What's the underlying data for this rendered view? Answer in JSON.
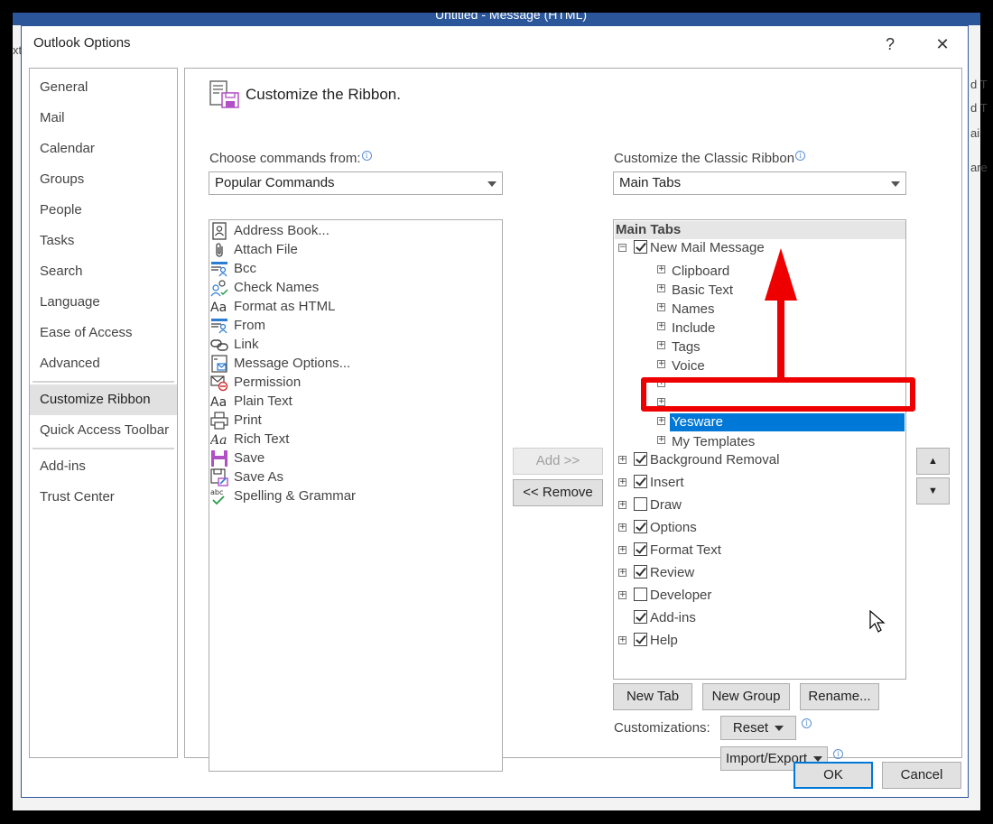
{
  "background": {
    "window_title": "Untitled - Message (HTML)",
    "left_fragment": "xt",
    "right_fragments": [
      "d T",
      "d T",
      "ai",
      "are"
    ]
  },
  "dialog": {
    "title": "Outlook Options",
    "help_label": "?",
    "close_label": "✕"
  },
  "nav": {
    "items": [
      {
        "label": "General"
      },
      {
        "label": "Mail"
      },
      {
        "label": "Calendar"
      },
      {
        "label": "Groups"
      },
      {
        "label": "People"
      },
      {
        "label": "Tasks"
      },
      {
        "label": "Search"
      },
      {
        "label": "Language"
      },
      {
        "label": "Ease of Access"
      },
      {
        "label": "Advanced"
      },
      {
        "label": "Customize Ribbon",
        "active": true
      },
      {
        "label": "Quick Access Toolbar"
      },
      {
        "label": "Add-ins"
      },
      {
        "label": "Trust Center"
      }
    ]
  },
  "page": {
    "title": "Customize the Ribbon.",
    "choose_label": "Choose commands from:",
    "choose_value": "Popular Commands",
    "customize_label": "Customize the Classic Ribbon",
    "customize_value": "Main Tabs"
  },
  "commands": [
    {
      "label": "Address Book...",
      "icon": "address-book-icon"
    },
    {
      "label": "Attach File",
      "icon": "paperclip-icon"
    },
    {
      "label": "Bcc",
      "icon": "bcc-icon"
    },
    {
      "label": "Check Names",
      "icon": "check-names-icon"
    },
    {
      "label": "Format as HTML",
      "icon": "format-html-icon"
    },
    {
      "label": "From",
      "icon": "from-icon"
    },
    {
      "label": "Link",
      "icon": "link-icon"
    },
    {
      "label": "Message Options...",
      "icon": "message-options-icon"
    },
    {
      "label": "Permission",
      "icon": "permission-icon"
    },
    {
      "label": "Plain Text",
      "icon": "plain-text-icon"
    },
    {
      "label": "Print",
      "icon": "printer-icon"
    },
    {
      "label": "Rich Text",
      "icon": "rich-text-icon"
    },
    {
      "label": "Save",
      "icon": "save-icon"
    },
    {
      "label": "Save As",
      "icon": "save-as-icon"
    },
    {
      "label": "Spelling & Grammar",
      "icon": "spelling-icon"
    }
  ],
  "buttons": {
    "add": "Add >>",
    "remove": "<< Remove",
    "new_tab": "New Tab",
    "new_group": "New Group",
    "rename": "Rename...",
    "reset": "Reset",
    "import_export": "Import/Export",
    "ok": "OK",
    "cancel": "Cancel",
    "move_up": "▲",
    "move_down": "▼"
  },
  "customizations_label": "Customizations:",
  "tree": {
    "header": "Main Tabs",
    "new_mail": "New Mail Message",
    "groups": [
      "Clipboard",
      "Basic Text",
      "Names",
      "Include",
      "Tags",
      "Voice",
      "",
      "",
      "Yesware",
      "My Templates"
    ],
    "selected_group": "Yesware",
    "tabs": [
      {
        "label": "Background Removal",
        "checked": true,
        "expander": true
      },
      {
        "label": "Insert",
        "checked": true,
        "expander": true
      },
      {
        "label": "Draw",
        "checked": false,
        "expander": true
      },
      {
        "label": "Options",
        "checked": true,
        "expander": true
      },
      {
        "label": "Format Text",
        "checked": true,
        "expander": true
      },
      {
        "label": "Review",
        "checked": true,
        "expander": true
      },
      {
        "label": "Developer",
        "checked": false,
        "expander": true
      },
      {
        "label": "Add-ins",
        "checked": true,
        "expander": false
      },
      {
        "label": "Help",
        "checked": true,
        "expander": true
      }
    ]
  },
  "colors": {
    "selection": "#0078d7",
    "annotation": "#ee0000",
    "title_bar": "#2b579a"
  }
}
